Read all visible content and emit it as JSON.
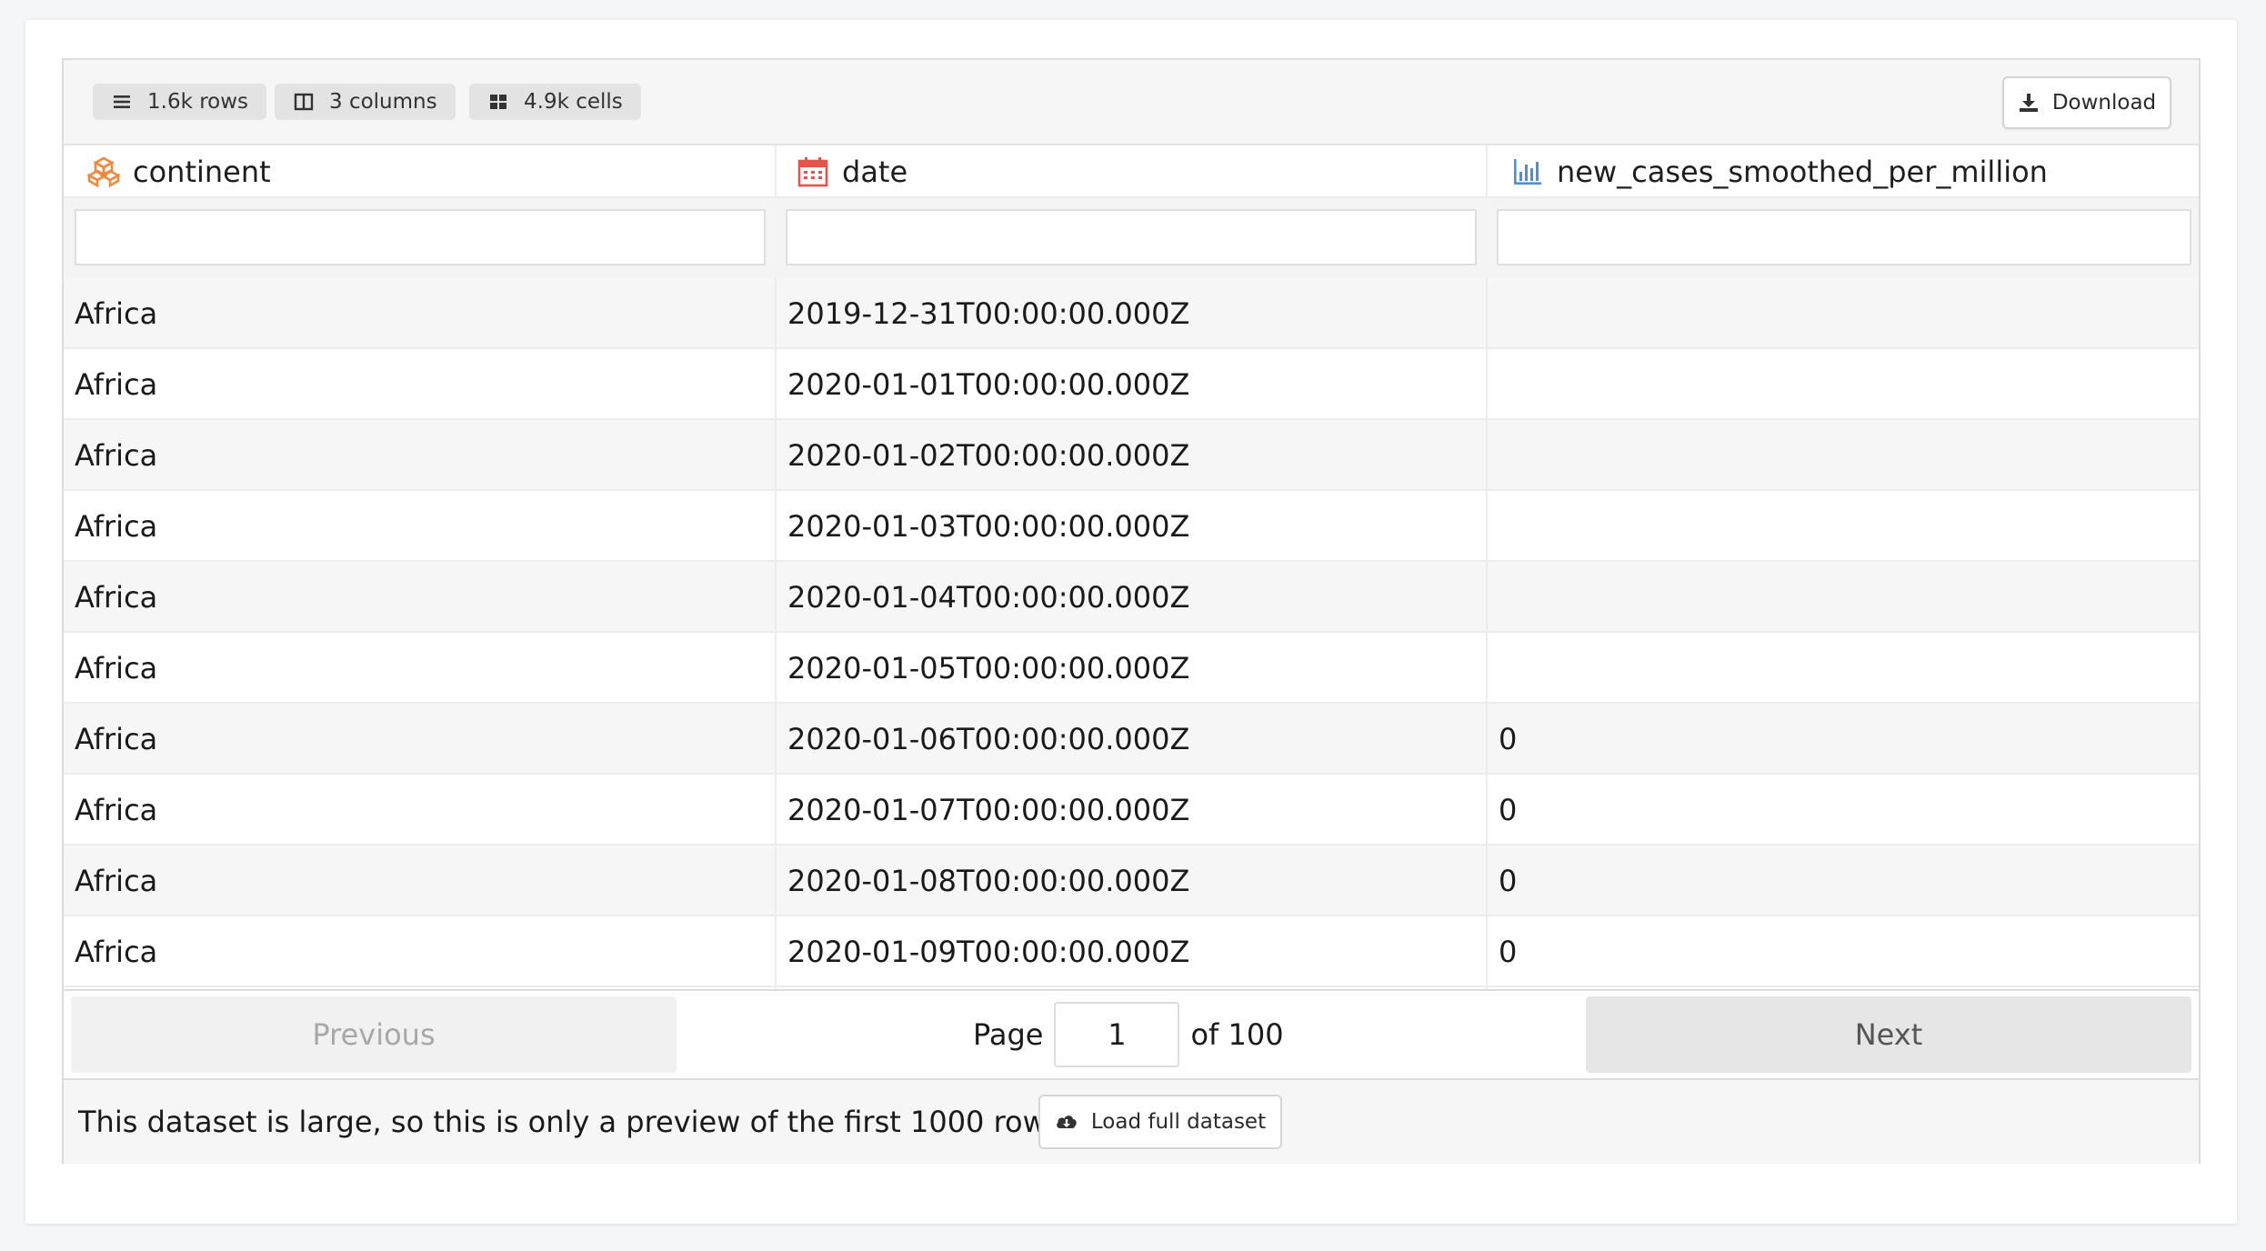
{
  "toolbar": {
    "chips": [
      {
        "icon": "rows-icon",
        "label": "1.6k rows"
      },
      {
        "icon": "columns-icon",
        "label": "3 columns"
      },
      {
        "icon": "cells-icon",
        "label": "4.9k cells"
      }
    ],
    "download_label": "Download"
  },
  "columns": [
    {
      "name": "continent",
      "icon": "categorical-icon",
      "icon_color": "#f0883e"
    },
    {
      "name": "date",
      "icon": "calendar-icon",
      "icon_color": "#e5534b"
    },
    {
      "name": "new_cases_smoothed_per_million",
      "icon": "numeric-chart-icon",
      "icon_color": "#4a90e2"
    }
  ],
  "filters": {
    "continent": "",
    "date": "",
    "new_cases_smoothed_per_million": ""
  },
  "rows": [
    {
      "continent": "Africa",
      "date": "2019-12-31T00:00:00.000Z",
      "value": ""
    },
    {
      "continent": "Africa",
      "date": "2020-01-01T00:00:00.000Z",
      "value": ""
    },
    {
      "continent": "Africa",
      "date": "2020-01-02T00:00:00.000Z",
      "value": ""
    },
    {
      "continent": "Africa",
      "date": "2020-01-03T00:00:00.000Z",
      "value": ""
    },
    {
      "continent": "Africa",
      "date": "2020-01-04T00:00:00.000Z",
      "value": ""
    },
    {
      "continent": "Africa",
      "date": "2020-01-05T00:00:00.000Z",
      "value": ""
    },
    {
      "continent": "Africa",
      "date": "2020-01-06T00:00:00.000Z",
      "value": "0"
    },
    {
      "continent": "Africa",
      "date": "2020-01-07T00:00:00.000Z",
      "value": "0"
    },
    {
      "continent": "Africa",
      "date": "2020-01-08T00:00:00.000Z",
      "value": "0"
    },
    {
      "continent": "Africa",
      "date": "2020-01-09T00:00:00.000Z",
      "value": "0"
    }
  ],
  "pagination": {
    "previous_label": "Previous",
    "next_label": "Next",
    "page_prefix": "Page",
    "current_page": "1",
    "of_label": "of 100"
  },
  "footer": {
    "note": "This dataset is large, so this is only a preview of the first 1000 rows.",
    "load_label": "Load full dataset"
  },
  "colors": {
    "chip_bg": "#e3e3e3",
    "stripe": "#f6f6f6",
    "border": "#dcdcdc"
  }
}
